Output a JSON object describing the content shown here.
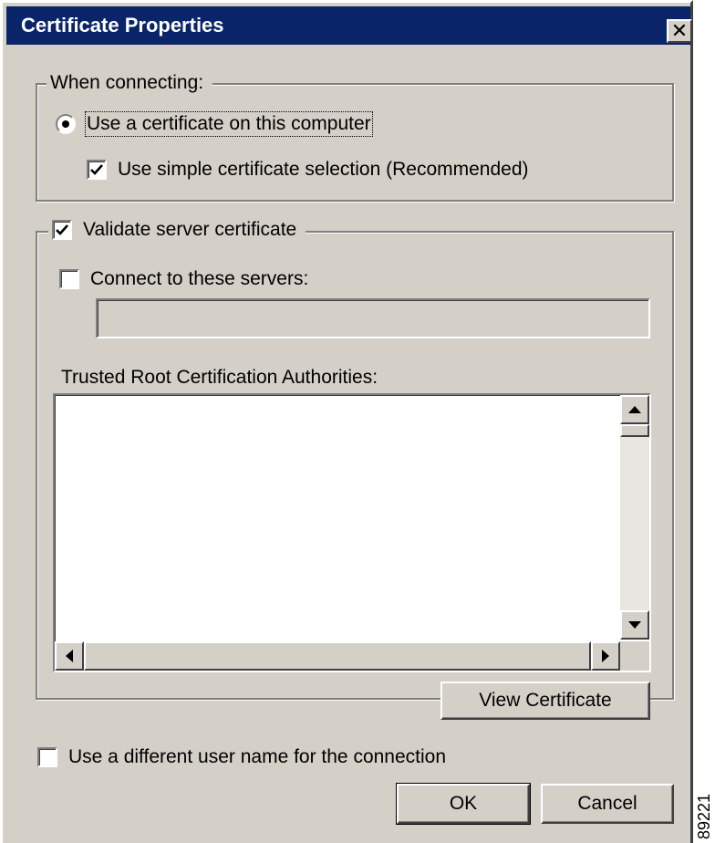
{
  "window": {
    "title": "Certificate Properties",
    "close_glyph": "✕"
  },
  "when_connecting": {
    "legend": "When connecting:",
    "use_certificate": {
      "label": "Use a certificate on this computer",
      "selected": true
    },
    "simple_selection": {
      "label": "Use simple certificate selection (Recommended)",
      "checked": true
    }
  },
  "validate": {
    "label": "Validate server certificate",
    "checked": true,
    "connect_servers": {
      "label": "Connect to these servers:",
      "checked": false,
      "value": ""
    },
    "trusted_root": {
      "label": "Trusted Root Certification Authorities:",
      "items": []
    },
    "view_certificate_label": "View Certificate"
  },
  "different_user": {
    "label": "Use a different user name for the connection",
    "checked": false
  },
  "buttons": {
    "ok": "OK",
    "cancel": "Cancel"
  },
  "side_id": "89221",
  "icons": {
    "check": "check-icon",
    "close": "close-icon",
    "arrows": [
      "arrow-up-icon",
      "arrow-down-icon",
      "arrow-left-icon",
      "arrow-right-icon"
    ]
  },
  "colors": {
    "titlebar": "#0a246a",
    "face": "#d4d0c8"
  }
}
